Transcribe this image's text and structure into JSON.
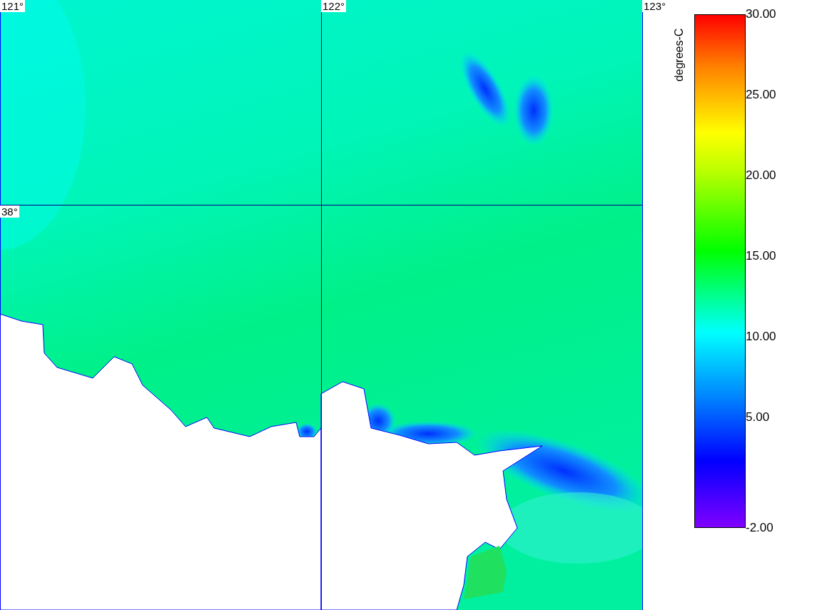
{
  "map": {
    "longitude_labels": [
      "121°",
      "122°",
      "123°"
    ],
    "latitude_labels": [
      "38°"
    ]
  },
  "colorbar": {
    "unit": "degrees-C",
    "tick_labels": [
      "30.00",
      "25.00",
      "20.00",
      "15.00",
      "10.00",
      "5.00",
      "-2.00"
    ]
  }
}
